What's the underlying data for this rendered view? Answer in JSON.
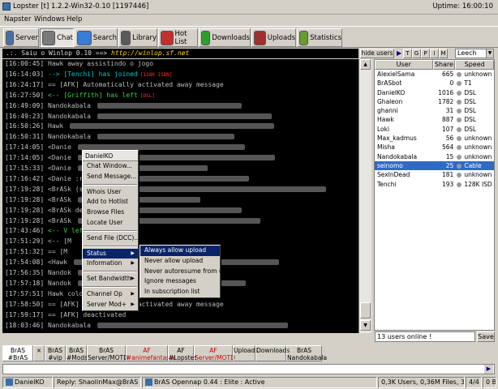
{
  "window": {
    "title": "Lopster [t] 1.2.2-Win32-0.10 [1197446]",
    "uptime": "Uptime: 16:00:10"
  },
  "menu": [
    "Napster",
    "Windows",
    "Help"
  ],
  "toolbar": [
    {
      "label": "Server",
      "icon": "server-icon",
      "color": "#4a6fa5"
    },
    {
      "label": "Chat",
      "icon": "chat-icon",
      "color": "#7a7a7a"
    },
    {
      "label": "Search",
      "icon": "search-icon",
      "color": "#3a7bd5"
    },
    {
      "label": "Library",
      "icon": "library-icon",
      "color": "#5a5a5a"
    },
    {
      "label": "Hot List",
      "icon": "hotlist-icon",
      "color": "#c03030"
    },
    {
      "label": "Downloads",
      "icon": "downloads-icon",
      "color": "#2e9e2e"
    },
    {
      "label": "Uploads",
      "icon": "uploads-icon",
      "color": "#a03030"
    },
    {
      "label": "Statistics",
      "icon": "statistics-icon",
      "color": "#6a9a30"
    }
  ],
  "banner": {
    "text": ".:. Saiu o Winlop 0.10 ==> ",
    "link": "http://winlop.sf.net"
  },
  "hide_users": "hide users",
  "flags": [
    "T",
    "G",
    "P",
    "I",
    "M"
  ],
  "search_value": "",
  "leech_select": "Leech",
  "chat_lines": [
    {
      "ts": "[16:00:45]",
      "kind": "action",
      "text": "Hawk away assistindo o jogo"
    },
    {
      "ts": "[16:14:03]",
      "kind": "join",
      "text": "--> [Tenchi] has joined",
      "tag": "[128K ISDN]"
    },
    {
      "ts": "[16:24:17]",
      "kind": "sys",
      "text": "== [AFK] Automatically activated away message"
    },
    {
      "ts": "[16:27:50]",
      "kind": "part",
      "text": "<-- [Griffith] has left",
      "tag": "[DSL]"
    },
    {
      "ts": "[16:49:09]",
      "kind": "msg",
      "text": "Nandokabala"
    },
    {
      "ts": "[16:49:23]",
      "kind": "msg",
      "text": "Nandokabala"
    },
    {
      "ts": "[16:50:26]",
      "kind": "msg",
      "text": "Hawk"
    },
    {
      "ts": "[16:50:31]",
      "kind": "msg",
      "text": "Nandokabala"
    },
    {
      "ts": "[17:14:05]",
      "kind": "msg",
      "text": "<Danie"
    },
    {
      "ts": "[17:14:05]",
      "kind": "msg",
      "text": "<Danie"
    },
    {
      "ts": "[17:15:33]",
      "kind": "msg",
      "text": "<Danie"
    },
    {
      "ts": "[17:16:42]",
      "kind": "msg",
      "text": "<Danie                          :r"
    },
    {
      "ts": "[17:19:28]",
      "kind": "msg",
      "text": "<BrASk                  (s) nova(s) ::"
    },
    {
      "ts": "[17:19:28]",
      "kind": "msg",
      "text": "<BrASk"
    },
    {
      "ts": "[17:19:28]",
      "kind": "msg",
      "text": "<BrASk                   de"
    },
    {
      "ts": "[17:19:28]",
      "kind": "msg",
      "text": "<BrASk"
    },
    {
      "ts": "[17:43:46]",
      "kind": "part",
      "text": "<--  V               left",
      "tag": "[MODEM]"
    },
    {
      "ts": "[17:51:29]",
      "kind": "sys",
      "text": "<-- [M"
    },
    {
      "ts": "[17:51:32]",
      "kind": "sys",
      "text": "== [M"
    },
    {
      "ts": "[17:54:08]",
      "kind": "msg",
      "text": "<Hawk"
    },
    {
      "ts": "[17:56:35]",
      "kind": "msg",
      "text": "Nandok"
    },
    {
      "ts": "[17:57:18]",
      "kind": "msg",
      "text": "Nandok"
    },
    {
      "ts": "[17:57:51]",
      "kind": "action",
      "text": "Hawk  coloquei mea share so d nao anime :D"
    },
    {
      "ts": "[17:58:50]",
      "kind": "sys",
      "text": "== [AFK] Automatically activated away message"
    },
    {
      "ts": "[17:59:17]",
      "kind": "sys",
      "text": "== [AFK] deactivated"
    },
    {
      "ts": "[18:03:46]",
      "kind": "msg",
      "text": "Nandokabala"
    }
  ],
  "user_columns": [
    "User",
    "Share",
    "Speed"
  ],
  "users": [
    {
      "name": "AlexielSama",
      "share": "665",
      "speed": "unknown"
    },
    {
      "name": "BrASbot",
      "share": "0",
      "speed": "T1"
    },
    {
      "name": "DanielKO",
      "share": "1016",
      "speed": "DSL"
    },
    {
      "name": "Ghaleon",
      "share": "1782",
      "speed": "DSL"
    },
    {
      "name": "ghanni",
      "share": "31",
      "speed": "DSL"
    },
    {
      "name": "Hawk",
      "share": "887",
      "speed": "DSL"
    },
    {
      "name": "Loki",
      "share": "107",
      "speed": "DSL"
    },
    {
      "name": "Max_kadmus",
      "share": "56",
      "speed": "unknown"
    },
    {
      "name": "Misha",
      "share": "564",
      "speed": "unknown"
    },
    {
      "name": "Nandokabala",
      "share": "15",
      "speed": "unknown"
    },
    {
      "name": "seinomo",
      "share": "25",
      "speed": "Cable"
    },
    {
      "name": "SexInDead",
      "share": "181",
      "speed": "unknown"
    },
    {
      "name": "Tenchi",
      "share": "193",
      "speed": "128K ISD"
    }
  ],
  "online_text": "13 users online !",
  "save_label": "Save",
  "tabs": [
    {
      "top": "BrAS",
      "bot": "#BrAS",
      "red": false
    },
    {
      "top": "×",
      "bot": "",
      "red": false
    },
    {
      "top": "BrAS",
      "bot": "#vip",
      "red": false
    },
    {
      "top": "BrAS",
      "bot": "#Mods",
      "red": false
    },
    {
      "top": "BrAS",
      "bot": "Server/MOTD",
      "red": false
    },
    {
      "top": "AF",
      "bot": "#animefantasia",
      "red": true
    },
    {
      "top": "AF",
      "bot": "#Lopster",
      "red": false
    },
    {
      "top": "AF",
      "bot": "Server/MOTD",
      "red": true
    },
    {
      "top": "",
      "bot": "Uploads",
      "red": false
    },
    {
      "top": "",
      "bot": "Downloads",
      "red": false
    },
    {
      "top": "BrAS",
      "bot": "Nandokabala",
      "red": false
    }
  ],
  "context_menu": {
    "header": "DanielKO",
    "items": [
      "Chat Window...",
      "Send Message...",
      "|",
      "Whois User",
      "Add to Hotlist",
      "Browse Files",
      "Locate User",
      "|",
      "Send File (DCC)...",
      "|",
      "Status",
      "Information",
      "|",
      "Set Bandwidth",
      "|",
      "Channel Op",
      "Server Mod+"
    ],
    "submenu": [
      "Always allow upload",
      "Never allow upload",
      "Never autoresume from user",
      "Ignore messages",
      "In subscription list"
    ]
  },
  "status": {
    "nick": "DanielKO",
    "reply": "Reply:  ShaolinMax@BrAS",
    "server": "BrAS   Opennap 0.44 : Elite : Active",
    "stats": "0,3K Users, 0,36M Files, 34,2 TB",
    "slots": "4/4",
    "transfer": "0 B"
  }
}
